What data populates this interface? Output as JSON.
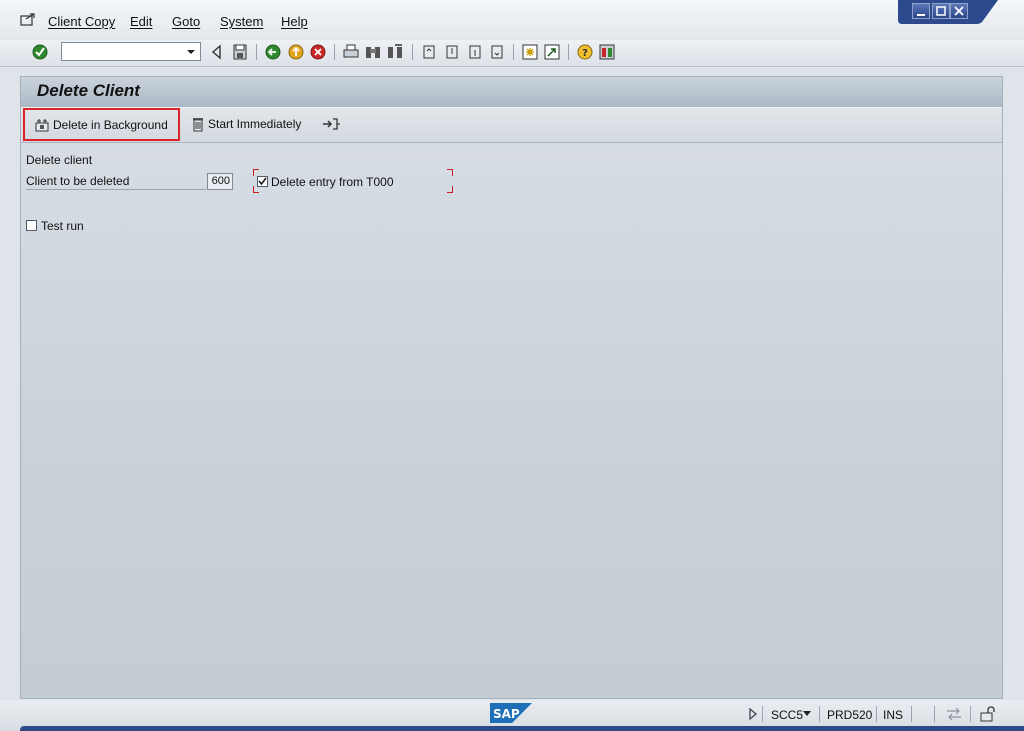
{
  "menu": {
    "items": [
      "Client Copy",
      "Edit",
      "Goto",
      "System",
      "Help"
    ]
  },
  "toolbar": {
    "command_value": "",
    "icons": [
      "enter-icon",
      "back-icon",
      "save-icon",
      "back-green-icon",
      "exit-icon",
      "cancel-icon",
      "print-icon",
      "find-icon",
      "find-next-icon",
      "first-page-icon",
      "prev-page-icon",
      "next-page-icon",
      "last-page-icon",
      "create-session-icon",
      "shortcut-icon",
      "help-icon",
      "layout-icon"
    ]
  },
  "window_controls": [
    "minimize",
    "maximize",
    "close"
  ],
  "screen": {
    "title": "Delete Client",
    "app_toolbar": {
      "delete_background_label": "Delete in Background",
      "start_immediately_label": "Start Immediately"
    },
    "form": {
      "group_label": "Delete client",
      "client_label": "Client to be deleted",
      "client_value": "600",
      "delete_entry_label": "Delete entry from T000",
      "delete_entry_checked": true,
      "test_run_label": "Test run",
      "test_run_checked": false
    }
  },
  "status": {
    "transaction": "SCC5",
    "system": "PRD520",
    "mode": "INS"
  },
  "colors": {
    "highlight": "#d9242a",
    "title_bar": "#aab7c4",
    "sap_blue": "#1d6fb8"
  }
}
